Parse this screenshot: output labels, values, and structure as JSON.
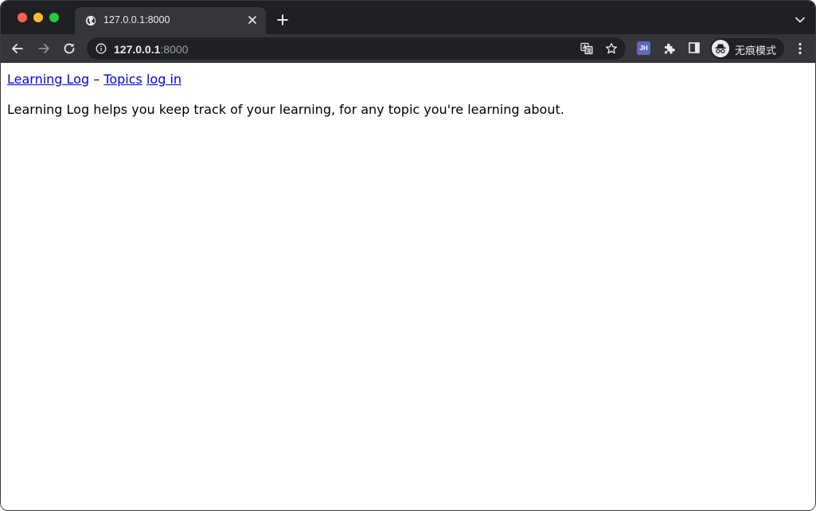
{
  "browser": {
    "tab": {
      "title": "127.0.0.1:8000"
    },
    "address_bar": {
      "host": "127.0.0.1",
      "port": ":8000"
    },
    "extensions": {
      "jh_label": "JH"
    },
    "profile": {
      "label": "无痕模式"
    },
    "colors": {
      "tabstrip_bg": "#1f2023",
      "toolbar_bg": "#35363a",
      "omnibox_bg": "#202124",
      "link": "#0000ee"
    },
    "icons": [
      "globe-icon",
      "close-icon",
      "plus-icon",
      "chevron-down-icon",
      "back-arrow-icon",
      "forward-arrow-icon",
      "reload-icon",
      "info-icon",
      "translate-icon",
      "star-icon",
      "puzzle-icon",
      "side-panel-icon",
      "incognito-icon",
      "more-vert-icon"
    ]
  },
  "page": {
    "nav": {
      "home_link": "Learning Log",
      "separator": " – ",
      "topics_link": "Topics",
      "login_link": "log in"
    },
    "description": "Learning Log helps you keep track of your learning, for any topic you're learning about."
  }
}
